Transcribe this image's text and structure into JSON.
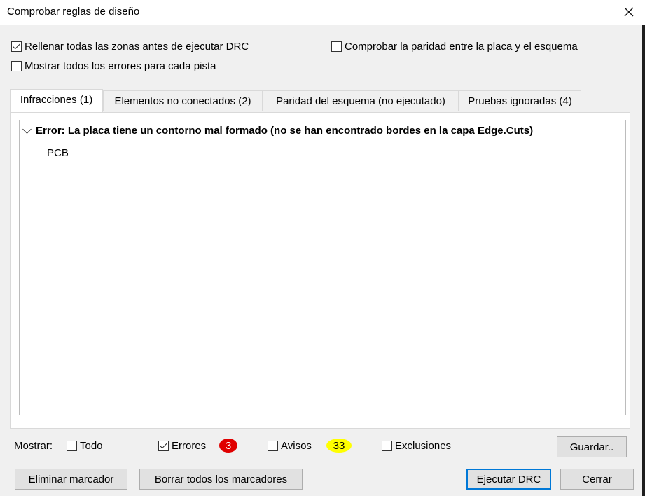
{
  "window": {
    "title": "Comprobar reglas de diseño"
  },
  "options": {
    "fill_zones_label": "Rellenar todas las zonas antes de ejecutar DRC",
    "show_all_errors_label": "Mostrar todos los errores para cada pista",
    "check_parity_label": "Comprobar la paridad entre la placa y el esquema"
  },
  "tabs": [
    {
      "label": "Infracciones (1)"
    },
    {
      "label": "Elementos no conectados (2)"
    },
    {
      "label": "Paridad del esquema (no ejecutado)"
    },
    {
      "label": "Pruebas ignoradas (4)"
    }
  ],
  "violations": [
    {
      "title": "Error: La placa tiene un contorno mal formado (no se han encontrado bordes en la capa Edge.Cuts)",
      "item": "PCB"
    }
  ],
  "filter": {
    "show_label": "Mostrar:",
    "all_label": "Todo",
    "errors_label": "Errores",
    "errors_count": "3",
    "warnings_label": "Avisos",
    "warnings_count": "33",
    "exclusions_label": "Exclusiones",
    "save_label": "Guardar.."
  },
  "buttons": {
    "delete_marker": "Eliminar marcador",
    "delete_all_markers": "Borrar todos los marcadores",
    "run_drc": "Ejecutar DRC",
    "close": "Cerrar"
  },
  "colors": {
    "errors_badge": "#e00000",
    "warnings_badge": "#ffff00",
    "default_button_border": "#0078d7"
  }
}
